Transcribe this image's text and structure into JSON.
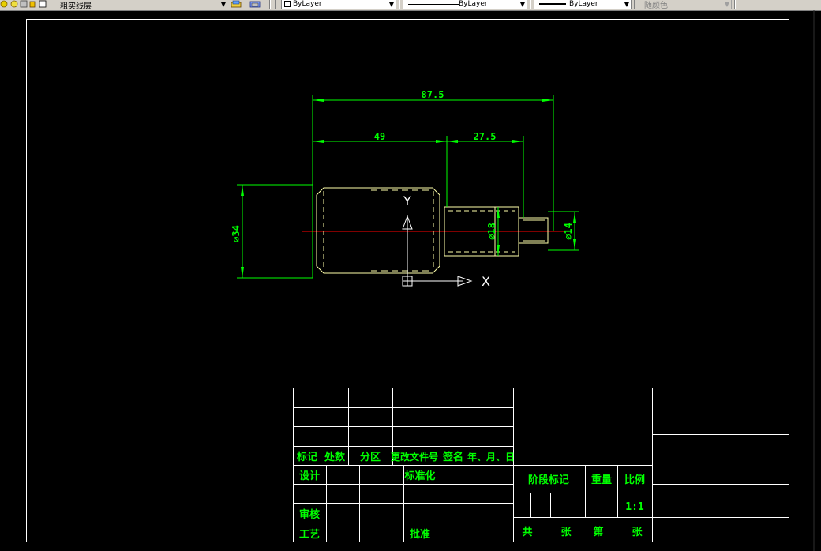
{
  "toolbar": {
    "layer_name": "粗实线层",
    "color_value": "ByLayer",
    "linetype_value": "ByLayer",
    "lineweight_value": "ByLayer",
    "plotstyle_value": "随颜色"
  },
  "drawing": {
    "dim_overall": "87.5",
    "dim_body": "49",
    "dim_shaft": "27.5",
    "dim_dia_body": "⌀34",
    "dim_dia_mid": "⌀18",
    "dim_dia_end": "⌀14",
    "axis_x": "X",
    "axis_y": "Y"
  },
  "title_block": {
    "biaoji": "标记",
    "chushu": "处数",
    "fenqu": "分区",
    "genggai": "更改文件号",
    "qianming": "签名",
    "date": "年、月、日",
    "sheji": "设计",
    "biaozhunhua": "标准化",
    "shenhe": "审核",
    "gongyi": "工艺",
    "pizhun": "批准",
    "jieduan": "阶段标记",
    "zhongliang": "重量",
    "bili": "比例",
    "scale_value": "1:1",
    "gong": "共",
    "zhang1": "张",
    "di": "第",
    "zhang2": "张"
  },
  "colors": {
    "dimension": "#00ff00",
    "outline": "#ffffaa",
    "centerline": "#ff0000",
    "frame": "#ffffff",
    "titletext": "#00ff00"
  }
}
